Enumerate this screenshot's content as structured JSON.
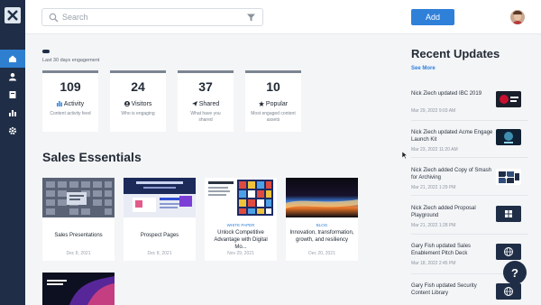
{
  "search": {
    "placeholder": "Search",
    "icon": "search-icon",
    "filter_icon": "filter-icon"
  },
  "topbar": {
    "add_label": "Add"
  },
  "sidebar": {
    "items": [
      {
        "name": "home",
        "icon": "home-icon",
        "active": true
      },
      {
        "name": "people",
        "icon": "person-icon",
        "active": false
      },
      {
        "name": "content",
        "icon": "book-icon",
        "active": false
      },
      {
        "name": "analytics",
        "icon": "bar-chart-icon",
        "active": false
      },
      {
        "name": "settings",
        "icon": "gear-icon",
        "active": false
      }
    ]
  },
  "engagement": {
    "period_label": "Last 30 days engagement",
    "stats": [
      {
        "value": "109",
        "label": "Activity",
        "icon": "bar-chart-icon",
        "desc": "Content activity feed"
      },
      {
        "value": "24",
        "label": "Visitors",
        "icon": "user-circle-icon",
        "desc": "Who is engaging"
      },
      {
        "value": "37",
        "label": "Shared",
        "icon": "paper-plane-icon",
        "desc": "What have you shared"
      },
      {
        "value": "10",
        "label": "Popular",
        "icon": "star-icon",
        "desc": "Most engaged content assets"
      }
    ]
  },
  "sales_essentials": {
    "title": "Sales Essentials",
    "cards": [
      {
        "tag": "",
        "title": "Sales Presentations",
        "date": "Dec 8, 2021"
      },
      {
        "tag": "",
        "title": "Prospect Pages",
        "date": "Dec 8, 2021"
      },
      {
        "tag": "WHITE PAPER",
        "title": "Unlock Competitive Advantage with Digital Mo...",
        "date": "Nov 29, 2021"
      },
      {
        "tag": "BLOG",
        "title": "Innovation, transformation, growth, and resiliency",
        "date": "Dec 20, 2021"
      },
      {
        "tag": "",
        "title": "",
        "date": ""
      }
    ]
  },
  "recent_updates": {
    "title": "Recent Updates",
    "see_more": "See More",
    "items": [
      {
        "text": "Nick Ziech updated IBC 2019",
        "date": "Mar 29, 2022 9:03 AM",
        "thumb": "ibc-event"
      },
      {
        "text": "Nick Ziech updated Acme Engage Launch Kit",
        "date": "Mar 23, 2022 11:20 AM",
        "thumb": "engage-kit"
      },
      {
        "text": "Nick Ziech added Copy of Smash for Archiving",
        "date": "Mar 21, 2022 1:29 PM",
        "thumb": "puzzle"
      },
      {
        "text": "Nick Ziech added Proposal Playground",
        "date": "Mar 21, 2022 1:28 PM",
        "thumb": "grid-icon"
      },
      {
        "text": "Gary Fish updated Sales Enablement Pitch Deck",
        "date": "Mar 18, 2022 2:45 PM",
        "thumb": "globe-icon"
      },
      {
        "text": "Gary Fish updated Security Content Library",
        "date": "",
        "thumb": "globe-icon"
      }
    ]
  },
  "help": {
    "label": "?"
  },
  "colors": {
    "sidebar": "#1f2e46",
    "accent": "#2f80d9",
    "active_nav": "#2f7fd1",
    "background": "#f4f5f7"
  }
}
